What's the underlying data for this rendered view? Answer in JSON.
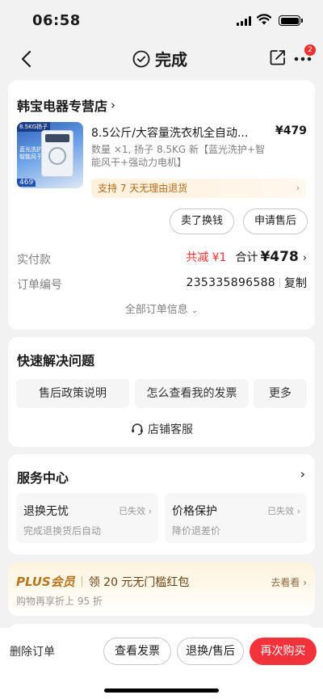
{
  "status_bar": {
    "time": "06:58"
  },
  "nav": {
    "title": "完成",
    "badge_count": "2"
  },
  "order": {
    "shop_name": "韩宝电器专营店",
    "product": {
      "title": "8.5公斤/大容量洗衣机全自动...",
      "price": "¥479",
      "spec": "数量 ×1, 扬子 8.5KG 新【蓝光洗护+智能风干+强动力电机】",
      "image_tags": {
        "top": "8.5KG扬子",
        "side": "蓝光洗护 智能风干",
        "price": "469"
      }
    },
    "return_tip": "支持 7 天无理由退货",
    "buttons": {
      "resell": "卖了换钱",
      "aftersale": "申请售后"
    },
    "paid_label": "实付款",
    "discount": "共减 ¥1",
    "total_label": "合计",
    "total_value": "¥478",
    "order_no_label": "订单编号",
    "order_no": "235335896588",
    "copy_label": "复制",
    "all_info": "全部订单信息"
  },
  "quick": {
    "title": "快速解决问题",
    "chips": [
      "售后政策说明",
      "怎么查看我的发票",
      "更多"
    ],
    "customer_service": "店铺客服"
  },
  "service": {
    "title": "服务中心",
    "items": [
      {
        "name": "退换无忧",
        "status": "已失效",
        "desc": "完成退换货后自动"
      },
      {
        "name": "价格保护",
        "status": "已失效",
        "desc": "降价退差价"
      }
    ]
  },
  "plus": {
    "logo": "PLUS会员",
    "offer": "领 20 元无门槛红包",
    "go": "去看看",
    "sub": "购物再享折上 95 折"
  },
  "bottom": {
    "delete": "删除订单",
    "invoice": "查看发票",
    "return": "退换/售后",
    "rebuy": "再次购买"
  },
  "colors": {
    "accent_red": "#f2333b",
    "plus_gold": "#b5761c",
    "tip_orange": "#b36b17"
  }
}
